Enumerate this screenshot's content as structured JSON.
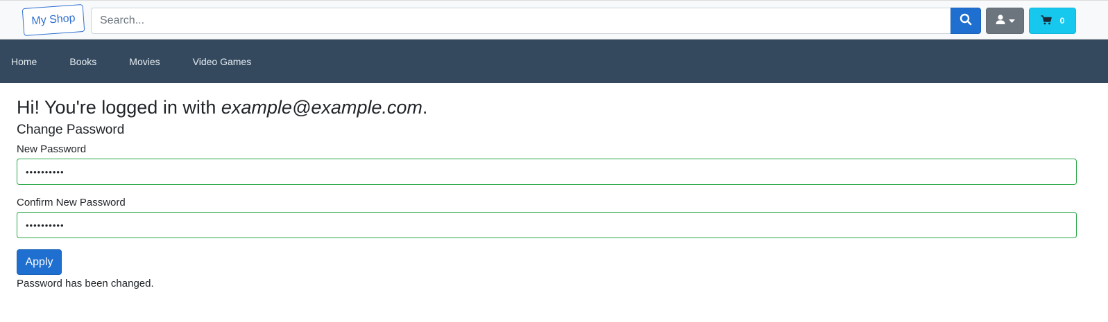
{
  "header": {
    "logo_text": "My Shop",
    "search": {
      "placeholder": "Search...",
      "value": ""
    },
    "search_button_icon": "search-icon",
    "user_button_icon": "user-icon",
    "user_dropdown_icon": "caret-down-icon",
    "cart": {
      "icon": "cart-icon",
      "count": "0"
    },
    "colors": {
      "primary": "#1f6fd0",
      "secondary": "#6c757d",
      "info": "#17c8ee"
    }
  },
  "nav": {
    "background": "#34495e",
    "items": [
      {
        "label": "Home"
      },
      {
        "label": "Books"
      },
      {
        "label": "Movies"
      },
      {
        "label": "Video Games"
      }
    ]
  },
  "main": {
    "greeting_prefix": "Hi! You're logged in with ",
    "email": "example@example.com",
    "greeting_suffix": ".",
    "section_title": "Change Password",
    "new_password": {
      "label": "New Password",
      "value": "••••••••••"
    },
    "confirm_password": {
      "label": "Confirm New Password",
      "value": "••••••••••"
    },
    "apply_label": "Apply",
    "status_message": "Password has been changed.",
    "valid_border_color": "#28a745"
  }
}
